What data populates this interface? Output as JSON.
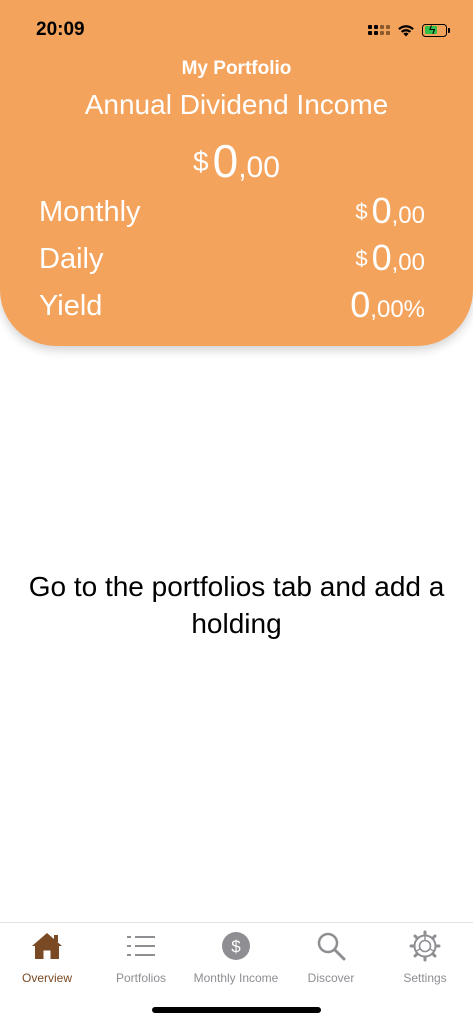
{
  "status_bar": {
    "time": "20:09"
  },
  "header": {
    "title": "My Portfolio",
    "subtitle": "Annual Dividend Income",
    "total": {
      "currency": "$",
      "whole": "0",
      "fraction": ",00"
    },
    "rows": [
      {
        "label": "Monthly",
        "currency": "$",
        "whole": "0",
        "fraction": ",00"
      },
      {
        "label": "Daily",
        "currency": "$",
        "whole": "0",
        "fraction": ",00"
      },
      {
        "label": "Yield",
        "currency": "",
        "whole": "0",
        "fraction": ",00%"
      }
    ]
  },
  "main": {
    "empty_message": "Go to the portfolios tab and add a holding"
  },
  "tabbar": {
    "tabs": [
      {
        "label": "Overview",
        "icon": "home-icon",
        "active": true
      },
      {
        "label": "Portfolios",
        "icon": "list-icon",
        "active": false
      },
      {
        "label": "Monthly Income",
        "icon": "dollar-circle-icon",
        "active": false
      },
      {
        "label": "Discover",
        "icon": "search-icon",
        "active": false
      },
      {
        "label": "Settings",
        "icon": "gear-icon",
        "active": false
      }
    ]
  },
  "colors": {
    "header": "#F4A35C",
    "active_tab": "#7A4A25",
    "inactive_tab": "#8E8E93"
  }
}
